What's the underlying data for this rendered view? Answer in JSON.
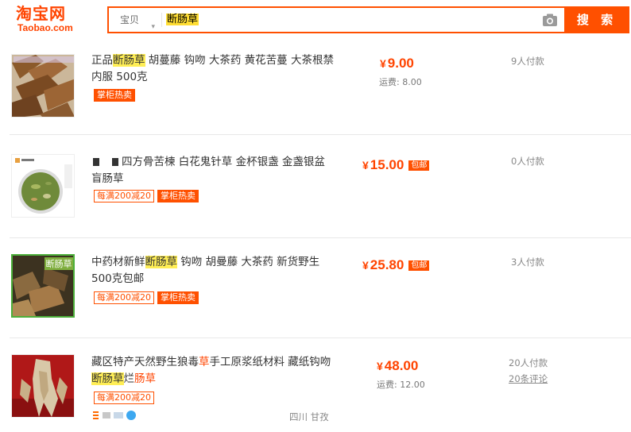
{
  "header": {
    "logo_cn": "淘宝网",
    "logo_en": "Taobao.com",
    "search_type": "宝贝",
    "search_query": "断肠草",
    "search_button": "搜 索"
  },
  "items": [
    {
      "title_parts": [
        "正品",
        "断肠草",
        " 胡蔓藤 钩吻 大茶药 黄花苦蔓 大茶根禁内服 500克"
      ],
      "tags": [
        "掌柜热卖"
      ],
      "price": "9.00",
      "currency": "¥",
      "shipping": "运费: 8.00",
      "sales": "9人付款"
    },
    {
      "title_text": "四方骨苦楝 白花鬼针草 金杯银盏 金盏银盆 盲肠草",
      "tags": [
        "每满200减20",
        "掌柜热卖"
      ],
      "price": "15.00",
      "currency": "¥",
      "post_free": "包邮",
      "sales": "0人付款"
    },
    {
      "title_parts": [
        "中药材新鲜",
        "断肠草",
        " 钩吻 胡曼藤 大茶药 新货野生500克包邮"
      ],
      "tags": [
        "每满200减20",
        "掌柜热卖"
      ],
      "price": "25.80",
      "currency": "¥",
      "post_free": "包邮",
      "sales": "3人付款",
      "thumb_text": "断肠草"
    },
    {
      "title_parts": [
        "藏区特产天然野生狼毒",
        "草",
        "手工原浆纸材料 藏纸钩吻",
        "断肠草",
        "烂",
        "肠草"
      ],
      "tags": [
        "每满200减20"
      ],
      "price": "48.00",
      "currency": "¥",
      "shipping": "运费: 12.00",
      "sales": "20人付款",
      "reviews": "20条评论",
      "location": "四川 甘孜"
    }
  ],
  "colors": {
    "brand": "#ff5000",
    "price": "#ff4400",
    "highlight": "#ffee55"
  }
}
